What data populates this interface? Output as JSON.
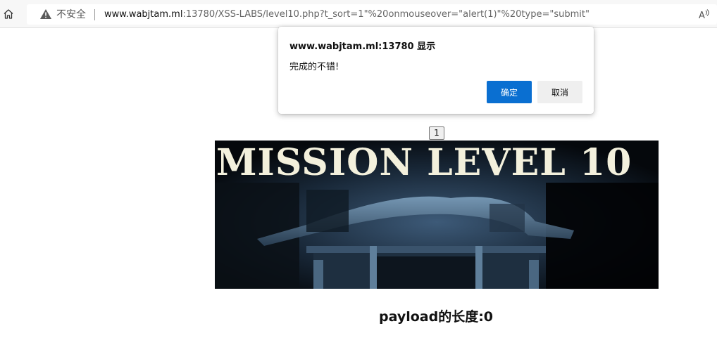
{
  "browser": {
    "security_label": "不安全",
    "url_host": "www.wabjtam.ml",
    "url_rest": ":13780/XSS-LABS/level10.php?t_sort=1\"%20onmouseover=\"alert(1)\"%20type=\"submit\"",
    "read_aloud_label": "Á"
  },
  "dialog": {
    "title": "www.wabjtam.ml:13780 显示",
    "message": "完成的不错!",
    "ok_label": "确定",
    "cancel_label": "取消"
  },
  "page": {
    "hidden_field_value": "1",
    "banner_title": "MISSION LEVEL 10",
    "payload_length_text": "payload的长度:0"
  }
}
